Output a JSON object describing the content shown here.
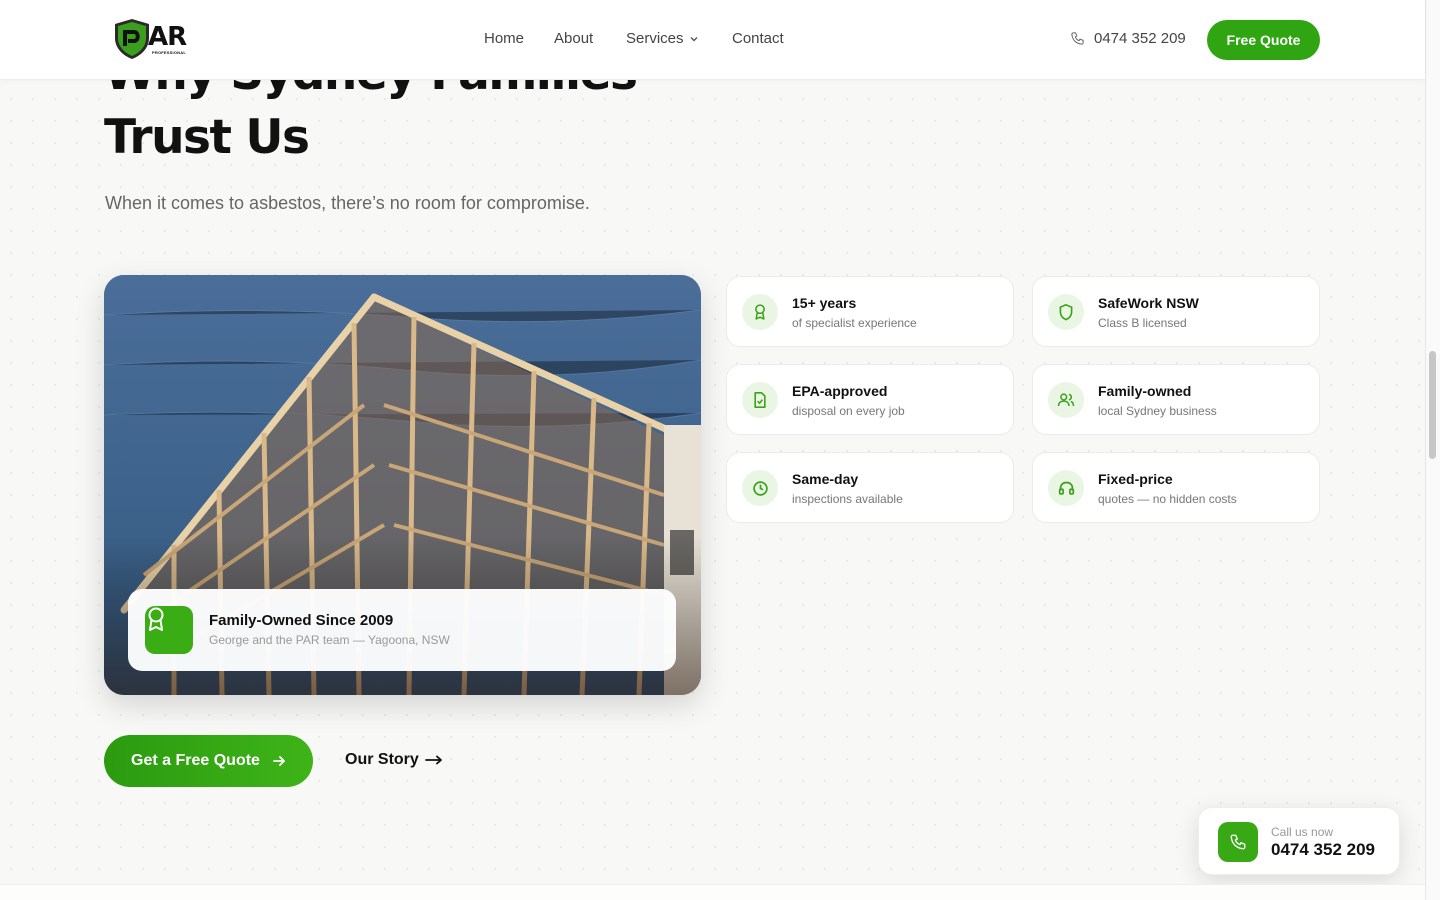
{
  "header": {
    "logo_text": "AR",
    "logo_sub": "PROFESSIONAL",
    "nav": [
      "Home",
      "About",
      "Services",
      "Contact"
    ],
    "phone": "0474 352 209",
    "cta": "Free Quote"
  },
  "hero": {
    "title_line1": "Why Sydney Families",
    "title_line2": "Trust Us",
    "subtitle": "When it comes to asbestos, there’s no room for compromise."
  },
  "badge": {
    "title": "Family-Owned Since 2009",
    "subtitle": "George and the PAR team — Yagoona, NSW"
  },
  "features": [
    {
      "title": "15+ years",
      "subtitle": "of specialist experience",
      "icon": "award-icon"
    },
    {
      "title": "SafeWork NSW",
      "subtitle": "Class B licensed",
      "icon": "shield-icon"
    },
    {
      "title": "EPA-approved",
      "subtitle": "disposal on every job",
      "icon": "document-check-icon"
    },
    {
      "title": "Family-owned",
      "subtitle": "local Sydney business",
      "icon": "users-icon"
    },
    {
      "title": "Same-day",
      "subtitle": "inspections available",
      "icon": "clock-icon"
    },
    {
      "title": "Fixed-price",
      "subtitle": "quotes — no hidden costs",
      "icon": "headphones-icon"
    }
  ],
  "cta": {
    "primary": "Get a Free Quote",
    "secondary": "Our Story"
  },
  "call_card": {
    "label": "Call us now",
    "number": "0474 352 209"
  },
  "colors": {
    "brand_green": "#2fa512",
    "icon_bg": "#eaf5e4"
  }
}
